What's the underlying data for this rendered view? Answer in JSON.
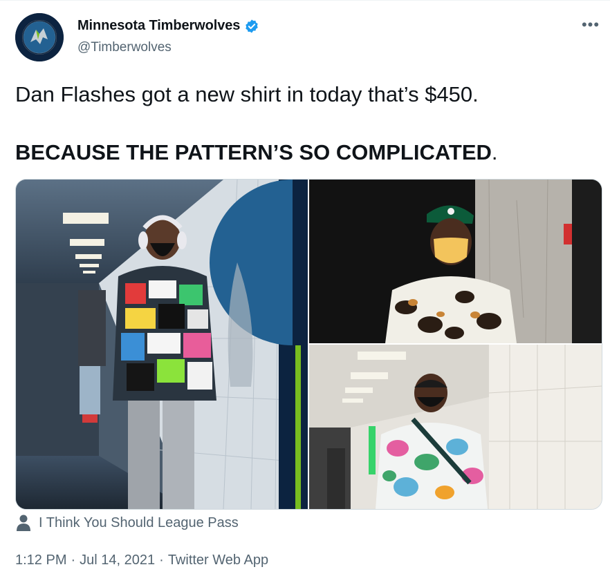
{
  "author": {
    "display_name": "Minnesota Timberwolves",
    "handle": "@Timberwolves",
    "verified": true,
    "avatar_icon": "timberwolves-logo-icon"
  },
  "more_icon": "more-horizontal-icon",
  "more_glyph": "•••",
  "tweet": {
    "line1": "Dan Flashes got a new shirt in today that’s $450.",
    "line2_bold": "BECAUSE THE PATTERN’S SO COMPLICATED",
    "line2_tail": "."
  },
  "media": {
    "photos": [
      {
        "icon": "photo-hallway-player-headphones"
      },
      {
        "icon": "photo-player-green-cap"
      },
      {
        "icon": "photo-player-floral-hoodie"
      }
    ]
  },
  "tag": {
    "icon": "person-icon",
    "label": "I Think You Should League Pass"
  },
  "meta": {
    "time": "1:12 PM",
    "sep1": "·",
    "date": "Jul 14, 2021",
    "sep2": "·",
    "source": "Twitter Web App"
  },
  "colors": {
    "text": "#0f1419",
    "secondary": "#536471",
    "verified_blue": "#1d9bf0",
    "border": "#cfd9de",
    "team_navy": "#0c2340",
    "team_green": "#78be20"
  }
}
